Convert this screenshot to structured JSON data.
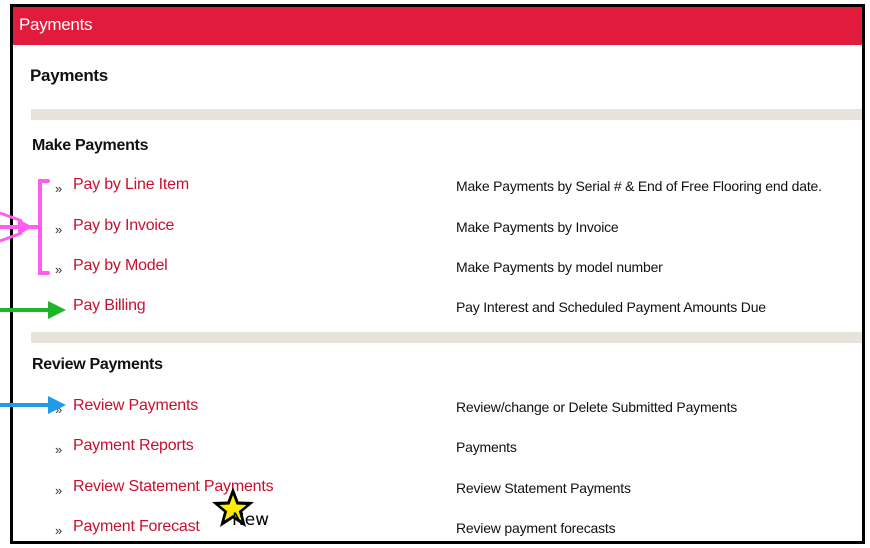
{
  "header": {
    "title": "Payments"
  },
  "page": {
    "title": "Payments"
  },
  "sections": {
    "make": {
      "heading": "Make Payments",
      "items": [
        {
          "label": "Pay by Line Item",
          "desc": "Make Payments by Serial # & End of Free Flooring end date."
        },
        {
          "label": "Pay by Invoice",
          "desc": "Make Payments by Invoice"
        },
        {
          "label": "Pay by Model",
          "desc": "Make Payments by model number"
        },
        {
          "label": "Pay Billing",
          "desc": "Pay Interest and Scheduled Payment Amounts Due"
        }
      ]
    },
    "review": {
      "heading": "Review Payments",
      "items": [
        {
          "label": "Review Payments",
          "desc": "Review/change or Delete Submitted Payments"
        },
        {
          "label": "Payment Reports",
          "desc": "Payments"
        },
        {
          "label": "Review Statement Payments",
          "desc": "Review Statement Payments"
        },
        {
          "label": "Payment Forecast",
          "desc": "Review payment forecasts"
        }
      ]
    }
  },
  "bullet": "»",
  "badge": {
    "text": "New",
    "icon": "star-icon"
  },
  "annotations": {
    "bracket_color": "#ff5cf0",
    "green_arrow_color": "#1db52a",
    "blue_arrow_color": "#1f9be8"
  },
  "colors": {
    "header_bg": "#e11b3c",
    "link": "#c8102e",
    "band": "#e6e3da"
  }
}
